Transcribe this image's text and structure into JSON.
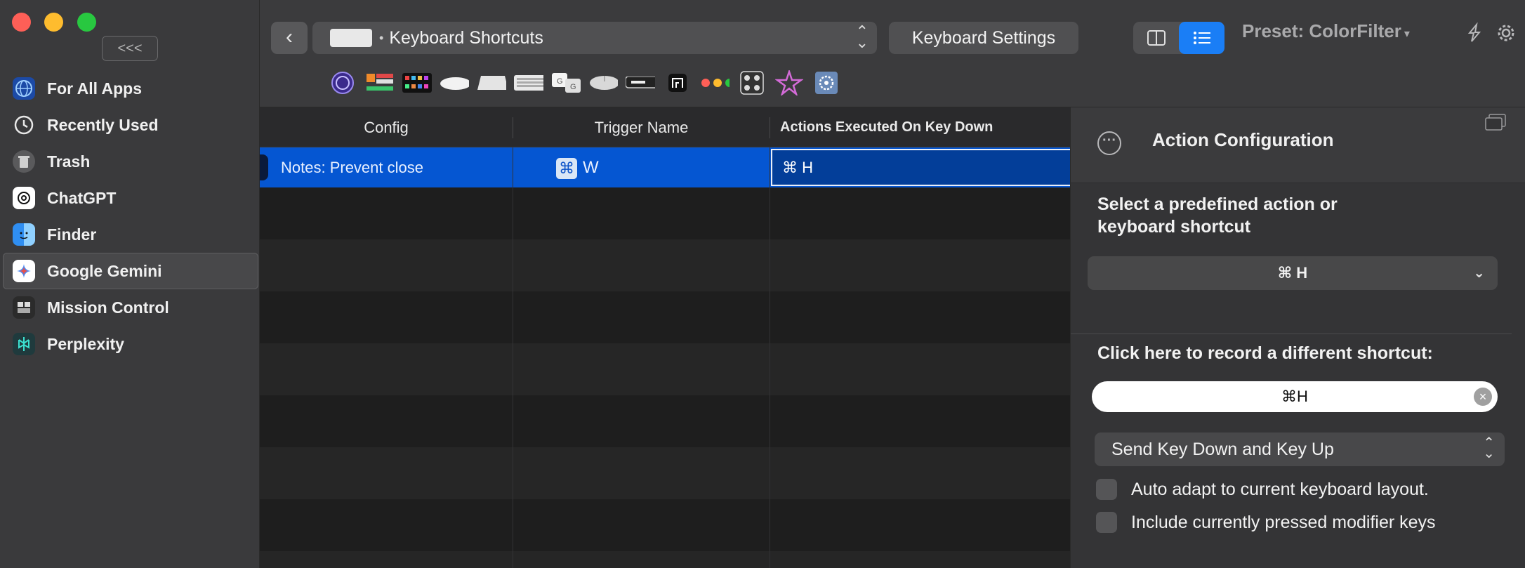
{
  "sidebar": {
    "collapse_label": "<<<",
    "items": [
      {
        "label": "For All Apps",
        "icon": "globe-icon",
        "color": "#2f6fd8"
      },
      {
        "label": "Recently Used",
        "icon": "clock-icon",
        "color": "#e8e8e8"
      },
      {
        "label": "Trash",
        "icon": "trash-icon",
        "color": "#8e8e90"
      },
      {
        "label": "ChatGPT",
        "icon": "chatgpt-icon",
        "color": "#ffffff"
      },
      {
        "label": "Finder",
        "icon": "finder-icon",
        "color": "#3aa0f5"
      },
      {
        "label": "Google Gemini",
        "icon": "gemini-icon",
        "color": "#ffffff"
      },
      {
        "label": "Mission Control",
        "icon": "mission-control-icon",
        "color": "#2b2b2b"
      },
      {
        "label": "Perplexity",
        "icon": "perplexity-icon",
        "color": "#1f3a3d"
      }
    ],
    "selected_index": 5
  },
  "header": {
    "picker_dot": "•",
    "picker_label": "Keyboard Shortcuts",
    "keyboard_settings_label": "Keyboard Settings",
    "preset_label": "Preset: ColorFilter",
    "preset_caret": "▾"
  },
  "trigger_types": [
    "siri-orb-icon",
    "touch-bar-icon",
    "stream-deck-icon",
    "magic-mouse-icon",
    "trackpad-icon",
    "keyboard-icon",
    "key-sequence-icon",
    "normal-mouse-icon",
    "remote-icon",
    "drawing-icon",
    "window-buttons-icon",
    "midi-icon",
    "stylus-icon",
    "automation-icon"
  ],
  "table": {
    "headers": {
      "config": "Config",
      "trigger": "Trigger Name",
      "actions": "Actions Executed On Key Down"
    },
    "rows": [
      {
        "config": "Notes: Prevent close",
        "trigger_symbol": "⌘",
        "trigger_key": "W",
        "action": "⌘ H"
      }
    ]
  },
  "panel": {
    "title": "Action Configuration",
    "select_label_line1": "Select a predefined action or",
    "select_label_line2": "keyboard shortcut",
    "predefined_value": "⌘ H",
    "record_label": "Click here to record a different shortcut:",
    "recorded_value": "⌘H",
    "send_mode": "Send Key Down and Key Up",
    "checkbox_auto_adapt": "Auto adapt to current keyboard layout.",
    "checkbox_modifiers": "Include currently pressed modifier keys",
    "auto_adapt_checked": false,
    "modifiers_checked": false
  },
  "colors": {
    "accent": "#1a7ef6",
    "selection": "#0556d2"
  }
}
